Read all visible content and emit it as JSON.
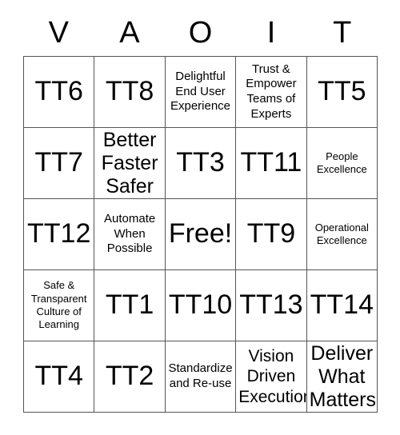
{
  "card": {
    "title_letters": [
      "V",
      "A",
      "O",
      "I",
      "T"
    ],
    "free_space_label": "Free!",
    "border_color": "#555555",
    "text_color": "#000000",
    "background_color": "#ffffff",
    "rows": [
      [
        {
          "text": "TT6",
          "size": "xl"
        },
        {
          "text": "TT8",
          "size": "xl"
        },
        {
          "text": "Delightful End User Experience",
          "size": "sm"
        },
        {
          "text": "Trust & Empower Teams of Experts",
          "size": "sm"
        },
        {
          "text": "TT5",
          "size": "xl"
        }
      ],
      [
        {
          "text": "TT7",
          "size": "xl"
        },
        {
          "text": "Better Faster Safer",
          "size": "lg"
        },
        {
          "text": "TT3",
          "size": "xl"
        },
        {
          "text": "TT11",
          "size": "xl"
        },
        {
          "text": "People Excellence",
          "size": "xs"
        }
      ],
      [
        {
          "text": "TT12",
          "size": "xl"
        },
        {
          "text": "Automate When Possible",
          "size": "sm"
        },
        {
          "text": "Free!",
          "size": "xl"
        },
        {
          "text": "TT9",
          "size": "xl"
        },
        {
          "text": "Operational Excellence",
          "size": "xs"
        }
      ],
      [
        {
          "text": "Safe & Transparent Culture of Learning",
          "size": "xs"
        },
        {
          "text": "TT1",
          "size": "xl"
        },
        {
          "text": "TT10",
          "size": "xl"
        },
        {
          "text": "TT13",
          "size": "xl"
        },
        {
          "text": "TT14",
          "size": "xl"
        }
      ],
      [
        {
          "text": "TT4",
          "size": "xl"
        },
        {
          "text": "TT2",
          "size": "xl"
        },
        {
          "text": "Standardize and Re-use",
          "size": "sm"
        },
        {
          "text": "Vision Driven Execution",
          "size": "md"
        },
        {
          "text": "Deliver What Matters",
          "size": "lg"
        }
      ]
    ]
  }
}
